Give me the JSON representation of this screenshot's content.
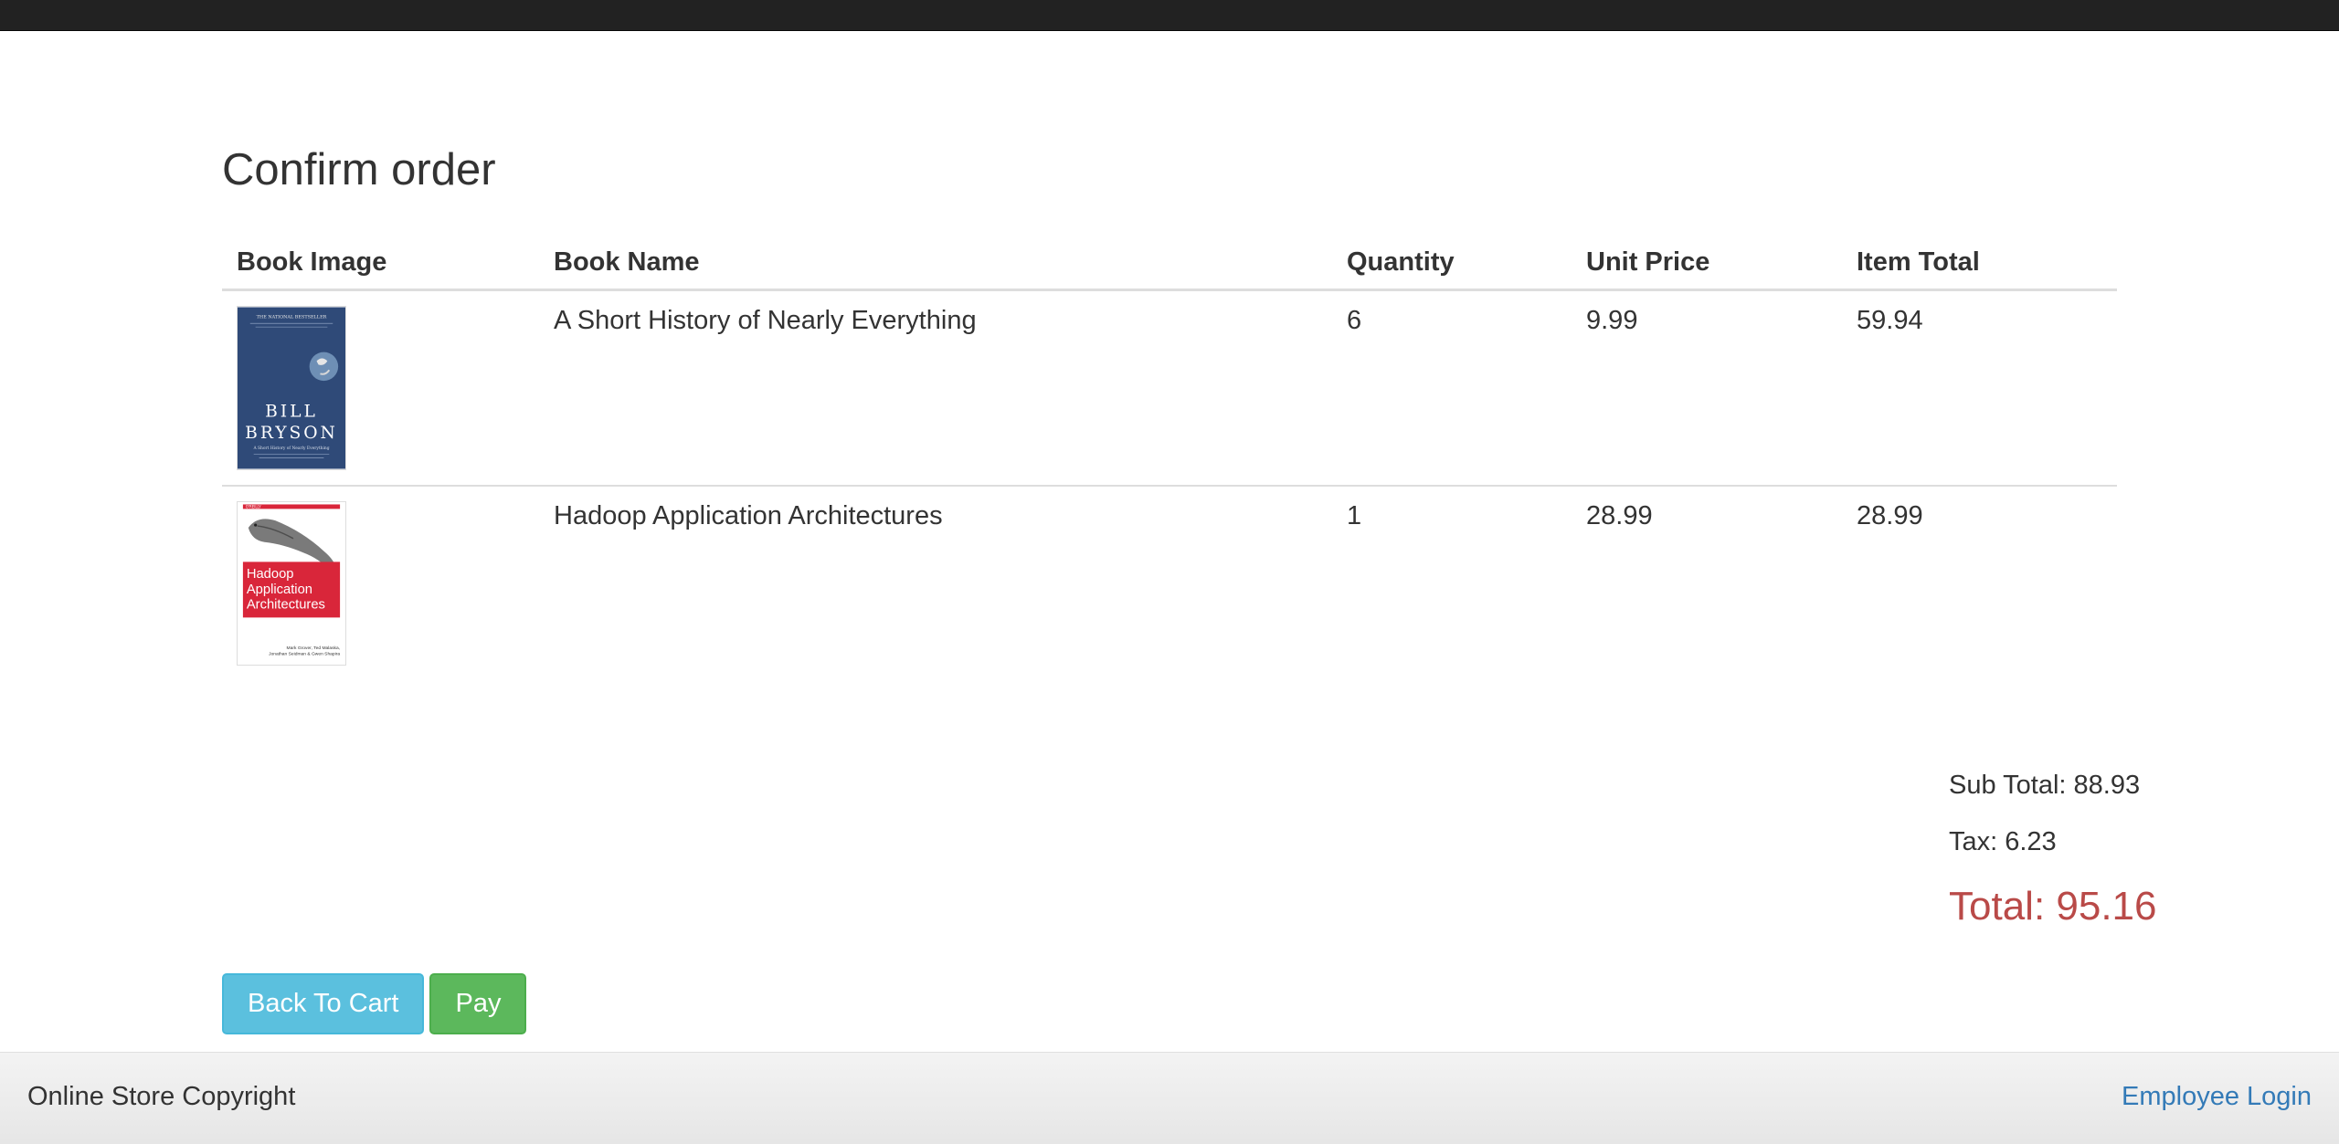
{
  "page": {
    "title": "Confirm order"
  },
  "table": {
    "headers": [
      "Book Image",
      "Book Name",
      "Quantity",
      "Unit Price",
      "Item Total"
    ],
    "rows": [
      {
        "name": "A Short History of Nearly Everything",
        "quantity": "6",
        "unit_price": "9.99",
        "item_total": "59.94",
        "cover": {
          "tagline": "THE NATIONAL BESTSELLER",
          "author_line1": "BILL",
          "author_line2": "BRYSON",
          "subtitle": "A Short History of Nearly Everything",
          "bg_color": "#2f4a78"
        }
      },
      {
        "name": "Hadoop Application Architectures",
        "quantity": "1",
        "unit_price": "28.99",
        "item_total": "28.99",
        "cover": {
          "publisher": "O'REILLY",
          "title_line1": "Hadoop",
          "title_line2": "Application",
          "title_line3": "Architectures",
          "authors_line1": "Mark Grover, Ted Malaska,",
          "authors_line2": "Jonathan Seidman & Gwen Shapira",
          "accent_color": "#d9263a"
        }
      }
    ]
  },
  "summary": {
    "sub_total": "Sub Total: 88.93",
    "tax": "Tax: 6.23",
    "total": "Total: 95.16"
  },
  "actions": {
    "back_label": "Back To Cart",
    "pay_label": "Pay"
  },
  "footer": {
    "copyright": "Online Store Copyright",
    "employee_login": "Employee Login"
  },
  "colors": {
    "topbar": "#222222",
    "info_button": "#5bc0de",
    "success_button": "#5cb85c",
    "total_text": "#b94a48",
    "link": "#337ab7"
  }
}
